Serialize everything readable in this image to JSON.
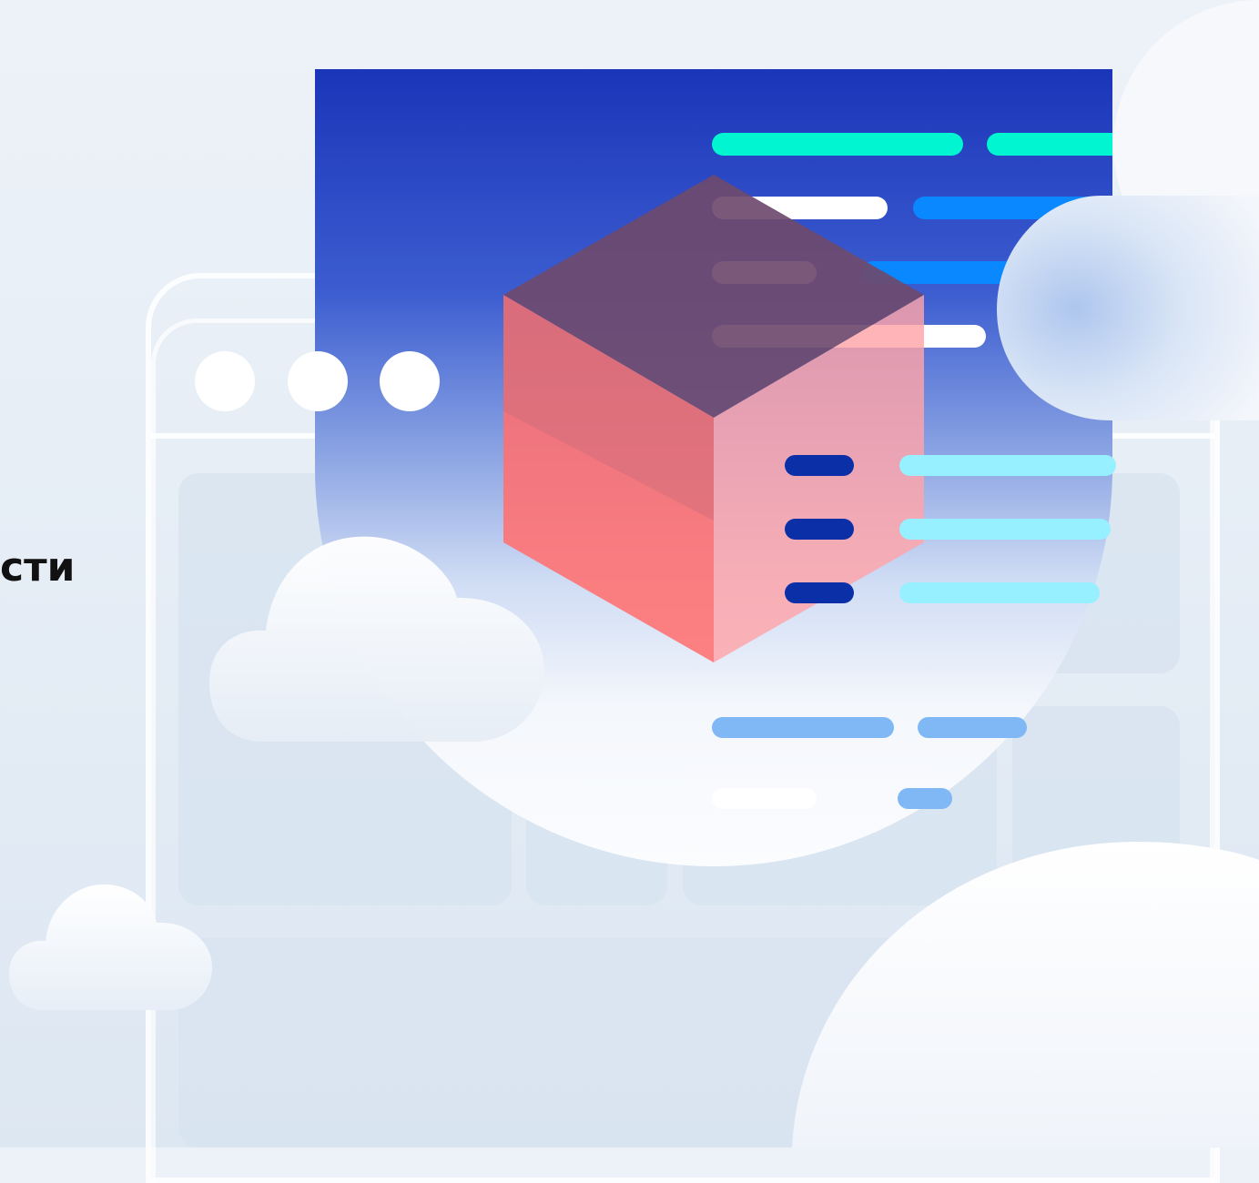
{
  "headline": {
    "text": "сти"
  },
  "illustration": {
    "code_lines_icon": "code-lines",
    "cube_icon": "cube",
    "window_dots_icon": "window-dots",
    "cloud_icon": "cloud"
  },
  "colors": {
    "screen_top": "#1b35b9",
    "cube_top": "#6e4a6e",
    "cube_left": "#ff6f70",
    "cube_right": "#ffa4a8",
    "accent_teal": "#00f5d0",
    "accent_blue": "#0a88ff",
    "accent_light_cyan": "#96f0ff",
    "accent_navy": "#0a2fa6",
    "light_blue_bar": "#7fb8f5"
  }
}
